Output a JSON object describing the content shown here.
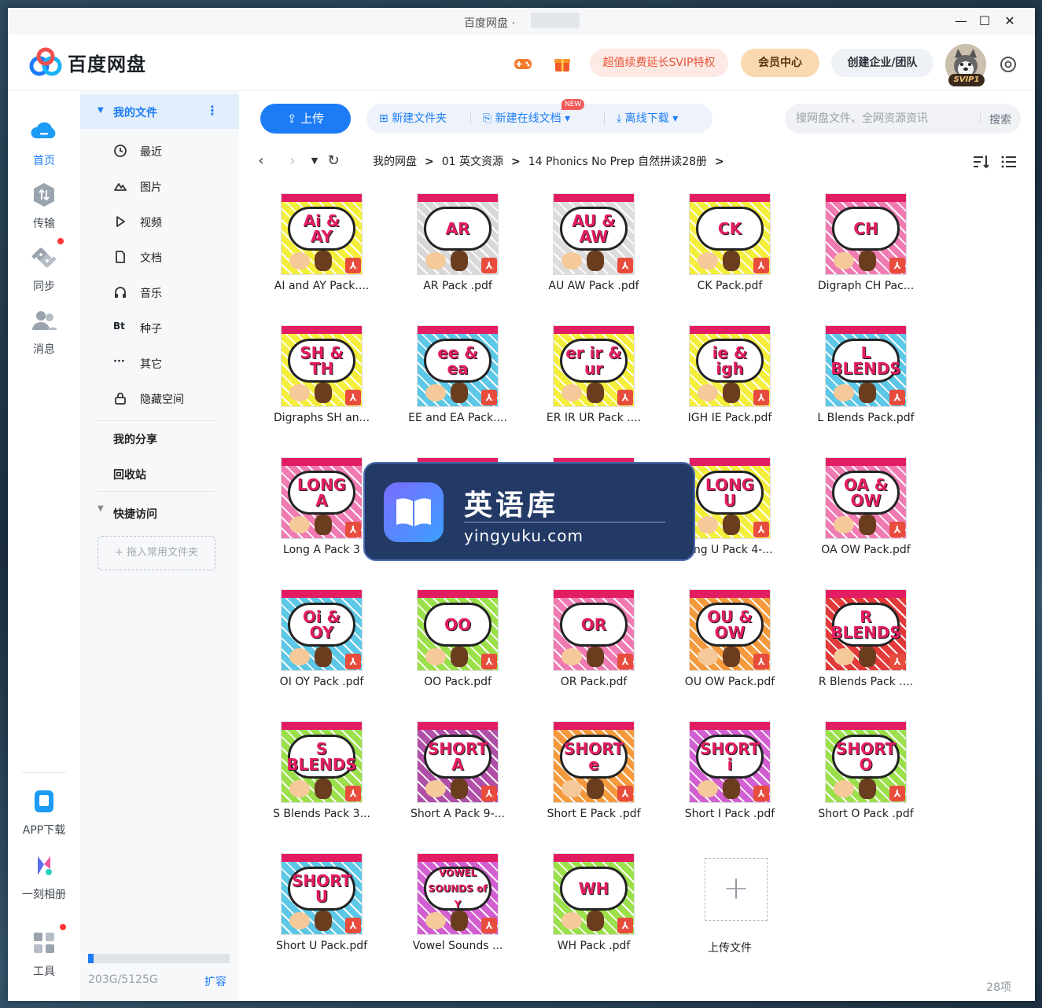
{
  "window": {
    "title": "百度网盘 ·"
  },
  "header": {
    "logo_text": "百度网盘",
    "svip_promo": "超值续费延长SVIP特权",
    "vip_center": "会员中心",
    "enterprise": "创建企业/团队",
    "svip_badge": "SVIP1"
  },
  "rail": {
    "items": [
      {
        "label": "首页",
        "icon": "cloud-icon"
      },
      {
        "label": "传输",
        "icon": "transfer-icon"
      },
      {
        "label": "同步",
        "icon": "sync-icon"
      },
      {
        "label": "消息",
        "icon": "people-icon"
      }
    ],
    "bottom": [
      {
        "label": "APP下载",
        "icon": "phone-icon"
      },
      {
        "label": "一刻相册",
        "icon": "album-icon"
      },
      {
        "label": "工具",
        "icon": "tools-icon"
      }
    ]
  },
  "sidebar": {
    "my_files": "我的文件",
    "more": "⋮",
    "items": [
      {
        "label": "最近",
        "icon": "clock-icon"
      },
      {
        "label": "图片",
        "icon": "image-icon"
      },
      {
        "label": "视频",
        "icon": "play-icon"
      },
      {
        "label": "文档",
        "icon": "document-icon"
      },
      {
        "label": "音乐",
        "icon": "headphones-icon"
      },
      {
        "label": "种子",
        "icon": "bt-icon",
        "glyph": "Bt"
      },
      {
        "label": "其它",
        "icon": "more-icon",
        "glyph": "···"
      },
      {
        "label": "隐藏空间",
        "icon": "lock-icon"
      }
    ],
    "my_share": "我的分享",
    "recycle": "回收站",
    "quick_access": "快捷访问",
    "drop_hint": "+ 拖入常用文件夹",
    "storage_text": "203G/5125G",
    "storage_fraction": 0.04,
    "expand": "扩容"
  },
  "toolbar": {
    "upload": "上传",
    "new_folder": "新建文件夹",
    "new_online_doc": "新建在线文档",
    "new_badge": "NEW",
    "offline_download": "离线下载",
    "search_placeholder": "搜网盘文件、全网资源资讯",
    "search_button": "搜索"
  },
  "breadcrumb": [
    "我的网盘",
    "01 英文资源",
    "14 Phonics No Prep 自然拼读28册"
  ],
  "files": [
    {
      "name": "AI and AY Pack....",
      "thumb": "Ai & AY",
      "bg": "#f3ee3c"
    },
    {
      "name": "AR Pack .pdf",
      "thumb": "AR",
      "bg": "#d8d8d8"
    },
    {
      "name": "AU AW Pack .pdf",
      "thumb": "AU & AW",
      "bg": "#dcdcdc"
    },
    {
      "name": "CK Pack.pdf",
      "thumb": "CK",
      "bg": "#f3ee3c"
    },
    {
      "name": "Digraph CH Pac...",
      "thumb": "CH",
      "bg": "#f07ab2"
    },
    {
      "name": "Digraphs SH an...",
      "thumb": "SH & TH",
      "bg": "#f3ee3c"
    },
    {
      "name": "EE and EA Pack....",
      "thumb": "ee & ea",
      "bg": "#5cc7e6"
    },
    {
      "name": "ER IR UR Pack ....",
      "thumb": "er ir & ur",
      "bg": "#f3ee3c"
    },
    {
      "name": "IGH IE Pack.pdf",
      "thumb": "ie & igh",
      "bg": "#f3ee3c"
    },
    {
      "name": "L Blends Pack.pdf",
      "thumb": "L BLENDS",
      "bg": "#5cc7e6"
    },
    {
      "name": "Long A Pack 3",
      "thumb": "LONG A",
      "bg": "#f07ab2"
    },
    {
      "name": "",
      "thumb": "",
      "bg": "#b98be0"
    },
    {
      "name": "",
      "thumb": "",
      "bg": "#f3ee3c"
    },
    {
      "name": "ong U Pack 4-...",
      "thumb": "LONG U",
      "bg": "#f3ee3c"
    },
    {
      "name": "OA OW Pack.pdf",
      "thumb": "OA & OW",
      "bg": "#f07ab2"
    },
    {
      "name": "OI OY Pack .pdf",
      "thumb": "Oi & OY",
      "bg": "#5cc7e6"
    },
    {
      "name": "OO Pack.pdf",
      "thumb": "OO",
      "bg": "#9be04a"
    },
    {
      "name": "OR Pack.pdf",
      "thumb": "OR",
      "bg": "#f07ab2"
    },
    {
      "name": "OU OW Pack.pdf",
      "thumb": "OU & OW",
      "bg": "#f59a3c"
    },
    {
      "name": "R Blends Pack ....",
      "thumb": "R BLENDS",
      "bg": "#e23a3a"
    },
    {
      "name": "S Blends Pack 3...",
      "thumb": "S BLENDS",
      "bg": "#9be04a"
    },
    {
      "name": "Short A Pack 9-...",
      "thumb": "SHORT A",
      "bg": "#b04fa8"
    },
    {
      "name": "Short E Pack .pdf",
      "thumb": "SHORT e",
      "bg": "#f59a3c"
    },
    {
      "name": "Short I Pack .pdf",
      "thumb": "SHORT i",
      "bg": "#d25fd1"
    },
    {
      "name": "Short O Pack .pdf",
      "thumb": "SHORT O",
      "bg": "#9be04a"
    },
    {
      "name": "Short U Pack.pdf",
      "thumb": "SHORT U",
      "bg": "#5cc7e6"
    },
    {
      "name": "Vowel Sounds ...",
      "thumb": "VOWEL SOUNDS of Y",
      "bg": "#d25fd1"
    },
    {
      "name": "WH Pack .pdf",
      "thumb": "WH",
      "bg": "#9be04a"
    }
  ],
  "upload_tile": {
    "label": "上传文件",
    "glyph": "+"
  },
  "item_count": "28项",
  "watermark": {
    "title": "英语库",
    "url": "yingyuku.com"
  },
  "colors": {
    "accent": "#1c7cf5",
    "svip_text": "#e6533a",
    "pdf_badge": "#e84c3d"
  }
}
